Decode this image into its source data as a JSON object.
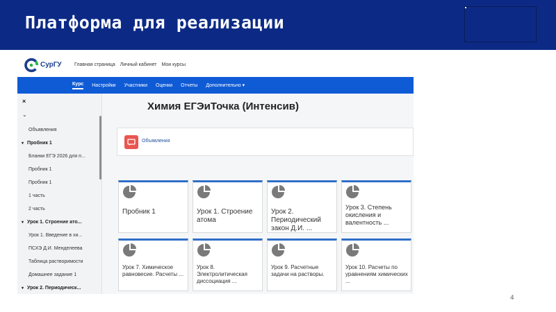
{
  "slide": {
    "title": "Платформа для реализации",
    "page_number": "4"
  },
  "site": {
    "logo_text": "СурГУ",
    "nav": [
      "Главная страница",
      "Личный кабинет",
      "Мои курсы"
    ]
  },
  "course_nav": {
    "tabs": [
      "Курс",
      "Настройки",
      "Участники",
      "Оценки",
      "Отчеты",
      "Дополнительно ▾"
    ],
    "active_tab": "Курс"
  },
  "sidebar": {
    "close": "×",
    "toggle": "⌄",
    "items": [
      {
        "label": "Объявления",
        "type": "item"
      },
      {
        "label": "Пробник 1",
        "type": "section"
      },
      {
        "label": "Бланки ЕГЭ 2026 для п...",
        "type": "item"
      },
      {
        "label": "Пробник 1",
        "type": "item"
      },
      {
        "label": "Пробник 1",
        "type": "item"
      },
      {
        "label": "1 часть",
        "type": "item"
      },
      {
        "label": "2 часть",
        "type": "item"
      },
      {
        "label": "Урок 1. Строение ато...",
        "type": "section"
      },
      {
        "label": "Урок 1. Введение в хи...",
        "type": "item"
      },
      {
        "label": "ПСХЭ Д.И. Менделеева",
        "type": "item"
      },
      {
        "label": "Таблица растворимости",
        "type": "item"
      },
      {
        "label": "Домашнее задание 1",
        "type": "item"
      },
      {
        "label": "Урок 2. Периодическ...",
        "type": "section"
      }
    ]
  },
  "course": {
    "title": "Химия ЕГЭиТочка (Интенсив)",
    "announcements_label": "Объявления"
  },
  "cards": [
    {
      "title": "Пробник 1"
    },
    {
      "title": "Урок 1. Строение атома"
    },
    {
      "title": "Урок 2. Периодический закон Д.И. ..."
    },
    {
      "title": "Урок 3. Степень окисления и валентность ..."
    },
    {
      "title": "Урок 7. Химическое равновесие. Расчеты ..."
    },
    {
      "title": "Урок 8. Электролитическая диссоциация ..."
    },
    {
      "title": "Урок 9. Расчетные задачи на растворы."
    },
    {
      "title": "Урок 10. Расчеты по уравнениям химических ..."
    }
  ],
  "colors": {
    "slide_header": "#0c2a85",
    "course_nav": "#0f5bd6",
    "card_accent": "#2f6fc7",
    "announcement_icon": "#e8564f"
  },
  "icons": {
    "card_icon": "pie-chart-icon",
    "announcement_icon": "forum-icon",
    "logo": "surgu-logo-icon"
  }
}
